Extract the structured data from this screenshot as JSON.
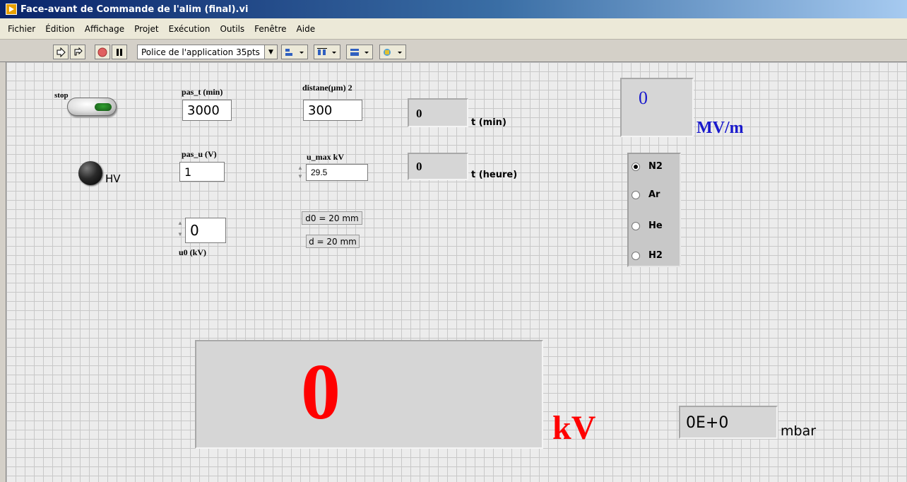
{
  "window": {
    "title": "Face-avant de Commande de l'alim (final).vi"
  },
  "menu": {
    "items": [
      "Fichier",
      "Édition",
      "Affichage",
      "Projet",
      "Exécution",
      "Outils",
      "Fenêtre",
      "Aide"
    ]
  },
  "toolbar": {
    "font_select": "Police de l'application 35pts",
    "buttons": [
      "run-arrow-icon",
      "run-continuously-icon",
      "abort-icon",
      "pause-icon",
      "align-icon",
      "distribute-icon",
      "resize-icon",
      "reorder-icon"
    ]
  },
  "panel": {
    "stop": {
      "label": "stop"
    },
    "hv": {
      "label": "HV"
    },
    "pas_t": {
      "label": "pas_t (min)",
      "value": "3000"
    },
    "pas_u": {
      "label": "pas_u (V)",
      "value": "1"
    },
    "u0": {
      "label": "u0 (kV)",
      "value": "0"
    },
    "distance": {
      "label": "distane(µm) 2",
      "value": "300"
    },
    "u_max": {
      "label": "u_max kV",
      "value": "29.5"
    },
    "d0": {
      "text": "d0 = 20 mm"
    },
    "d": {
      "text": "d = 20 mm"
    },
    "t_min": {
      "value": "0",
      "label": "t (min)"
    },
    "t_heure": {
      "value": "0",
      "label": "t (heure)"
    },
    "field": {
      "value": "0",
      "unit": "MV/m"
    },
    "gas": {
      "options": [
        "N2",
        "Ar",
        "He",
        "H2"
      ],
      "selected": "N2"
    },
    "voltage": {
      "value": "0",
      "unit": "kV"
    },
    "pressure": {
      "value": "0E+0",
      "unit": "mbar"
    }
  },
  "colors": {
    "voltage_red": "#ff0000",
    "field_blue": "#1a1acc"
  }
}
